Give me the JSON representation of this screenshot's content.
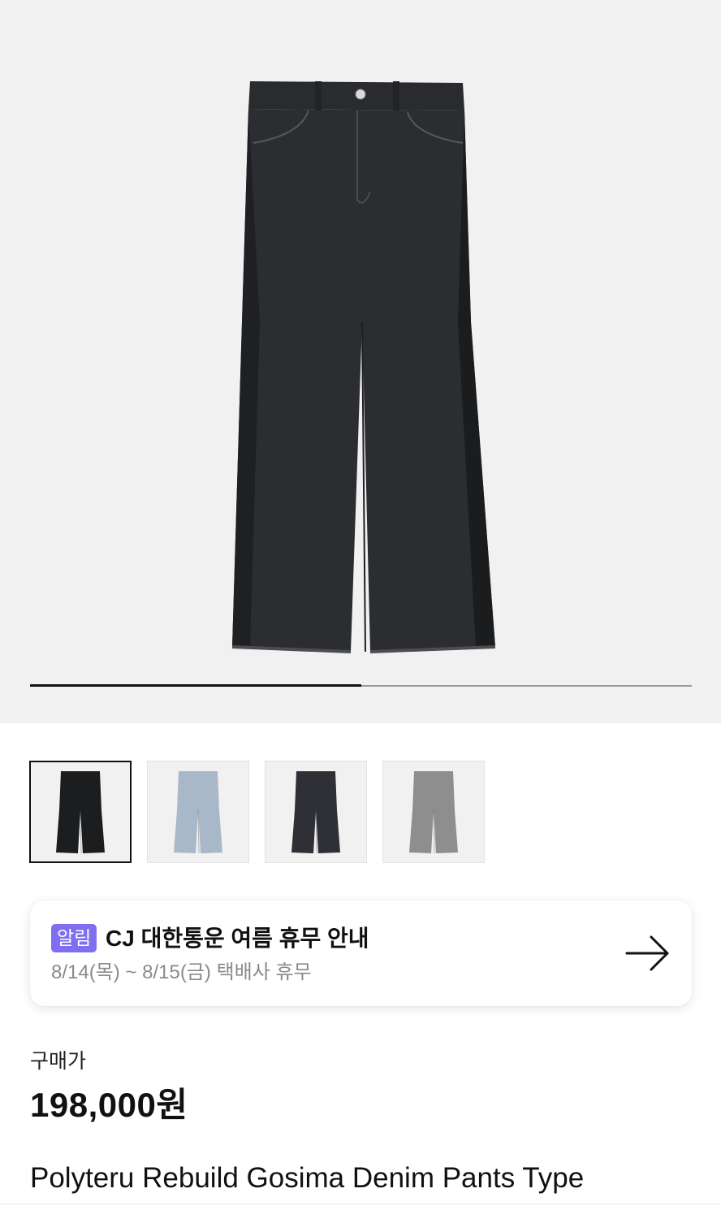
{
  "gallery": {
    "main_image": "black-wide-leg-denim-pants",
    "progress_fraction": 0.5,
    "thumbnails": [
      {
        "color": "#1c1d1f",
        "selected": true
      },
      {
        "color": "#a9b8c8",
        "selected": false
      },
      {
        "color": "#2e3036",
        "selected": false
      },
      {
        "color": "#8e8e8e",
        "selected": false
      }
    ]
  },
  "notice": {
    "badge": "알림",
    "title": "CJ 대한통운 여름 휴무 안내",
    "subtitle": "8/14(목) ~ 8/15(금) 택배사 휴무",
    "arrow_icon": "arrow-right-icon",
    "badge_color": "#7f6ef0"
  },
  "price": {
    "label": "구매가",
    "value": "198,000원"
  },
  "product": {
    "name": "Polyteru Rebuild Gosima Denim Pants Type"
  }
}
